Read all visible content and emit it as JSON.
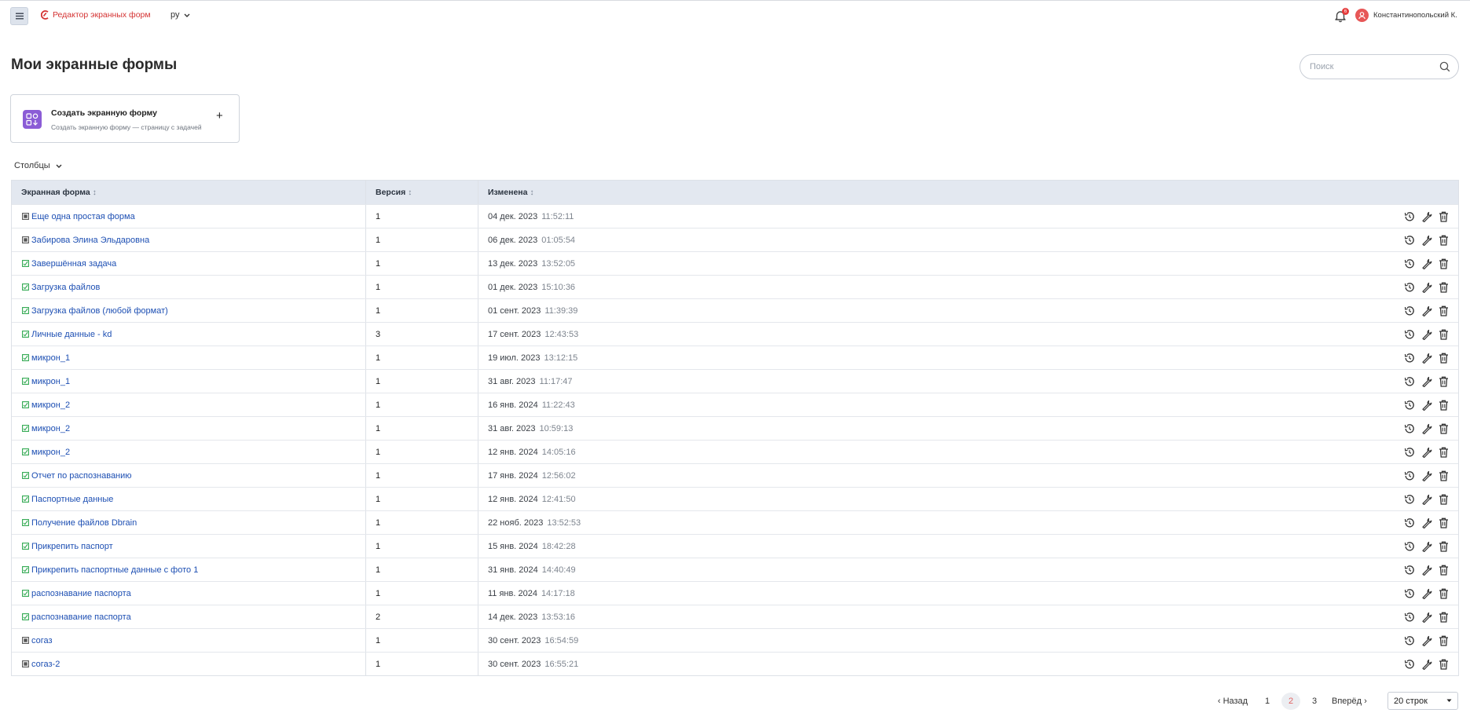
{
  "header": {
    "app_name": "Редактор экранных форм",
    "language": "ру",
    "notifications_count": "6",
    "user_name": "Константинопольский К."
  },
  "page": {
    "title": "Мои экранные формы",
    "search_placeholder": "Поиск"
  },
  "create_card": {
    "title": "Создать экранную форму",
    "subtitle": "Создать экранную форму — страницу с задачей",
    "plus": "+"
  },
  "columns_toggle": "Столбцы",
  "table": {
    "headers": {
      "form": "Экранная форма",
      "version": "Версия",
      "changed": "Изменена"
    },
    "rows": [
      {
        "name": "Еще одна простая форма",
        "icon": "grid-icon",
        "version": "1",
        "date": "04 дек. 2023",
        "time": "11:52:11"
      },
      {
        "name": "Забирова Элина Эльдаровна",
        "icon": "grid-icon",
        "version": "1",
        "date": "06 дек. 2023",
        "time": "01:05:54"
      },
      {
        "name": "Завершённая задача",
        "icon": "task-icon",
        "version": "1",
        "date": "13 дек. 2023",
        "time": "13:52:05"
      },
      {
        "name": "Загрузка файлов",
        "icon": "task-icon",
        "version": "1",
        "date": "01 дек. 2023",
        "time": "15:10:36"
      },
      {
        "name": "Загрузка файлов (любой формат)",
        "icon": "task-icon",
        "version": "1",
        "date": "01 сент. 2023",
        "time": "11:39:39"
      },
      {
        "name": "Личные данные - kd",
        "icon": "task-icon",
        "version": "3",
        "date": "17 сент. 2023",
        "time": "12:43:53"
      },
      {
        "name": "микрон_1",
        "icon": "task-icon",
        "version": "1",
        "date": "19 июл. 2023",
        "time": "13:12:15"
      },
      {
        "name": "микрон_1",
        "icon": "task-icon",
        "version": "1",
        "date": "31 авг. 2023",
        "time": "11:17:47"
      },
      {
        "name": "микрон_2",
        "icon": "task-icon",
        "version": "1",
        "date": "16 янв. 2024",
        "time": "11:22:43"
      },
      {
        "name": "микрон_2",
        "icon": "task-icon",
        "version": "1",
        "date": "31 авг. 2023",
        "time": "10:59:13"
      },
      {
        "name": "микрон_2",
        "icon": "task-icon",
        "version": "1",
        "date": "12 янв. 2024",
        "time": "14:05:16"
      },
      {
        "name": "Отчет по распознаванию",
        "icon": "task-icon",
        "version": "1",
        "date": "17 янв. 2024",
        "time": "12:56:02"
      },
      {
        "name": "Паспортные данные",
        "icon": "task-icon",
        "version": "1",
        "date": "12 янв. 2024",
        "time": "12:41:50"
      },
      {
        "name": "Получение файлов Dbrain",
        "icon": "task-icon",
        "version": "1",
        "date": "22 нояб. 2023",
        "time": "13:52:53"
      },
      {
        "name": "Прикрепить паспорт",
        "icon": "task-icon",
        "version": "1",
        "date": "15 янв. 2024",
        "time": "18:42:28"
      },
      {
        "name": "Прикрепить паспортные данные с фото 1",
        "icon": "task-icon",
        "version": "1",
        "date": "31 янв. 2024",
        "time": "14:40:49"
      },
      {
        "name": "распознавание паспорта",
        "icon": "task-icon",
        "version": "1",
        "date": "11 янв. 2024",
        "time": "14:17:18"
      },
      {
        "name": "распознавание паспорта",
        "icon": "task-icon",
        "version": "2",
        "date": "14 дек. 2023",
        "time": "13:53:16"
      },
      {
        "name": "согаз",
        "icon": "grid-icon",
        "version": "1",
        "date": "30 сент. 2023",
        "time": "16:54:59"
      },
      {
        "name": "согаз-2",
        "icon": "grid-icon",
        "version": "1",
        "date": "30 сент. 2023",
        "time": "16:55:21"
      }
    ]
  },
  "pagination": {
    "prev": "Назад",
    "pages": [
      "1",
      "2",
      "3"
    ],
    "current": "2",
    "next": "Вперёд",
    "rows_per_page": "20 строк"
  },
  "colors": {
    "accent": "#d43333",
    "link": "#1d4fb3",
    "header_bg": "#e3e8f0",
    "create_icon_bg": "#8b5cd6",
    "task_icon": "#2fa84f"
  }
}
